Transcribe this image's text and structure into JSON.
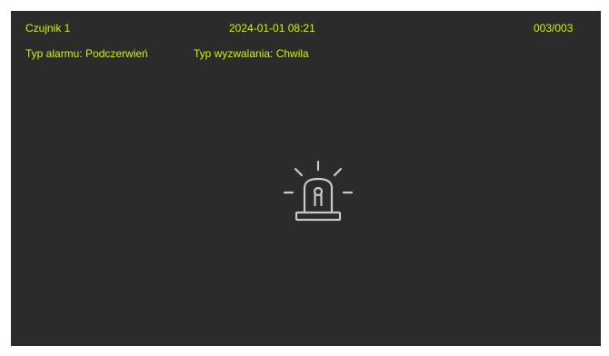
{
  "header": {
    "sensor_name": "Czujnik 1",
    "datetime": "2024-01-01  08:21",
    "counter": "003/003"
  },
  "info": {
    "alarm_type": "Typ alarmu: Podczerwień",
    "trigger_type": "Typ wyzwalania: Chwila"
  },
  "icon": {
    "name": "alarm-siren-icon"
  },
  "colors": {
    "background": "#2b2b2b",
    "text": "#d4f000",
    "icon": "#c8c8c8"
  }
}
